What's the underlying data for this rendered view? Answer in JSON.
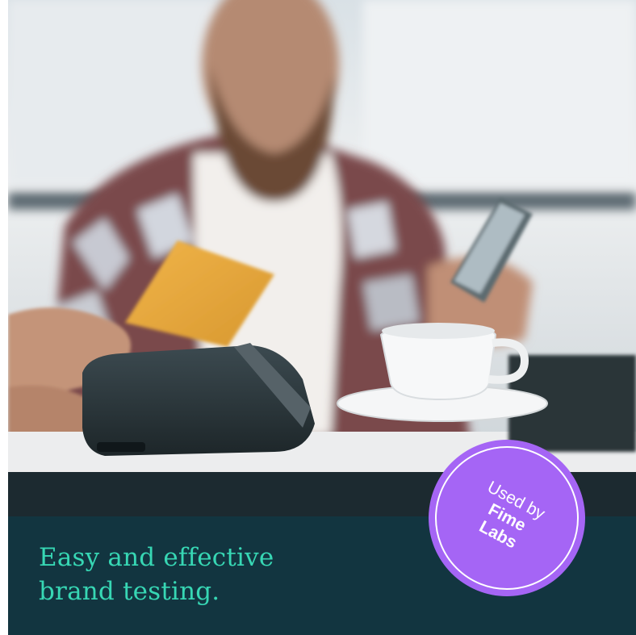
{
  "photo": {
    "alt_subject": "man-paying-with-card-at-terminal-icon"
  },
  "headline": {
    "line1": "Easy and effective",
    "line2": "brand testing."
  },
  "badge": {
    "line1": "Used by",
    "line2": "Fime Labs"
  },
  "colors": {
    "panel": "#123540",
    "headline": "#37d7b4",
    "badge": "#a565f5"
  }
}
